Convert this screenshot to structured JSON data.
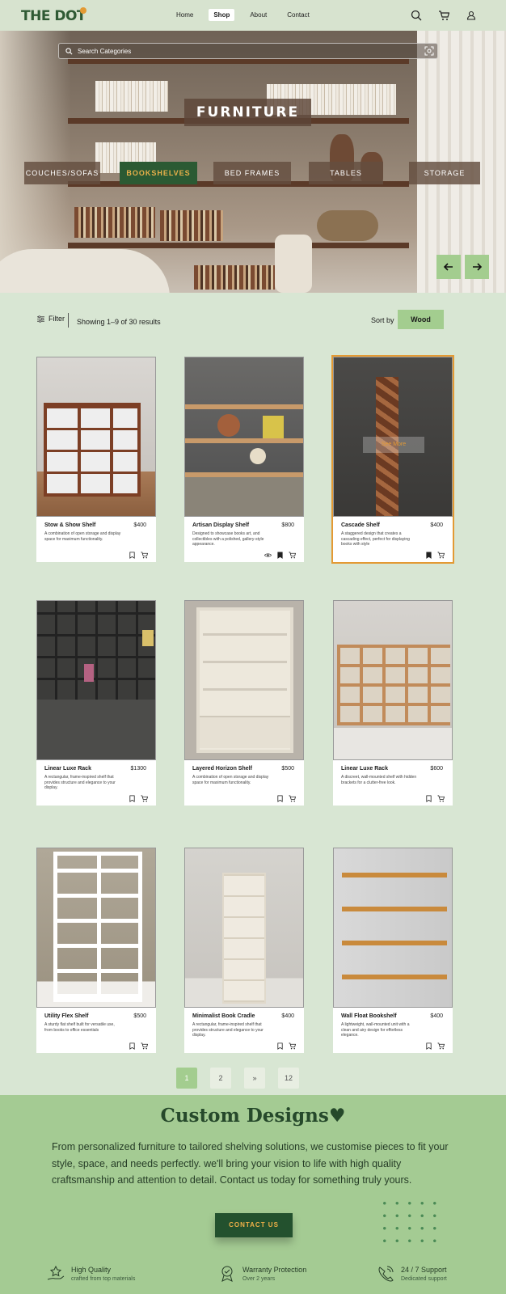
{
  "header": {
    "logo": "THE DOT",
    "nav": [
      {
        "label": "Home"
      },
      {
        "label": "Shop",
        "active": true
      },
      {
        "label": "About"
      },
      {
        "label": "Contact"
      }
    ],
    "icons": [
      "search-icon",
      "cart-icon",
      "user-icon"
    ]
  },
  "hero": {
    "search_placeholder": "Search Categories",
    "title": "FURNITURE",
    "categories": [
      {
        "label": "COUCHES/SOFAS"
      },
      {
        "label": "BOOKSHELVES",
        "active": true
      },
      {
        "label": "BED FRAMES"
      },
      {
        "label": "TABLES"
      },
      {
        "label": "STORAGE"
      }
    ]
  },
  "toolbar": {
    "filter_label": "Filter",
    "results_text": "Showing 1–9 of 30 results",
    "sort_label": "Sort by",
    "sort_value": "Wood"
  },
  "products": [
    {
      "name": "Stow & Show Shelf",
      "price": "$400",
      "desc": "A combination of open storage and display space for maximum functionality."
    },
    {
      "name": "Artisan Display Shelf",
      "price": "$800",
      "desc": "Designed to showcase books art, and collectibles with a polished, gallery-style appearance."
    },
    {
      "name": "Cascade Shelf",
      "price": "$400",
      "desc": "A staggered design that creates a cascading effect, perfect for displaying books with style",
      "overlay": "See More"
    },
    {
      "name": "Linear Luxe Rack",
      "price": "$1300",
      "desc": "A rectangular, frame-inspired shelf that provides structure and elegance to your display."
    },
    {
      "name": "Layered Horizon Shelf",
      "price": "$500",
      "desc": "A combination of open storage and display space for maximum functionality."
    },
    {
      "name": "Linear Luxe Rack",
      "price": "$600",
      "desc": "A discreet, wall-mounted shelf with hidden brackets for a clutter-free look."
    },
    {
      "name": "Utility Flex Shelf",
      "price": "$500",
      "desc": "A sturdy flat shelf built for versatile use, from books to office essentials"
    },
    {
      "name": "Minimalist Book Cradle",
      "price": "$400",
      "desc": "A rectangular, frame-inspired shelf that provides structure and elegance to your display."
    },
    {
      "name": "Wall Float Bookshelf",
      "price": "$400",
      "desc": "A lightweight, wall-mounted unit with a clean and airy design for effortless elegance."
    }
  ],
  "pagination": [
    "1",
    "2",
    "»",
    "12"
  ],
  "custom": {
    "title": "Custom Designs♥",
    "text": "From personalized furniture to tailored shelving solutions, we customise pieces to fit your style, space, and needs perfectly. we'll bring your vision to life with high quality craftsmanship and attention to detail. Contact us today for something truly yours.",
    "button": "CONTACT US"
  },
  "features": [
    {
      "title": "High Quality",
      "sub": "crafted from top materials",
      "icon": "quality-hand-icon"
    },
    {
      "title": "Warranty Protection",
      "sub": "Over 2 years",
      "icon": "warranty-badge-icon"
    },
    {
      "title": "24 / 7 Support",
      "sub": "Dedicated support",
      "icon": "support-phone-icon"
    }
  ],
  "colors": {
    "accent": "#a3cd8f",
    "dark_green": "#23512e",
    "orange": "#e39a34"
  }
}
